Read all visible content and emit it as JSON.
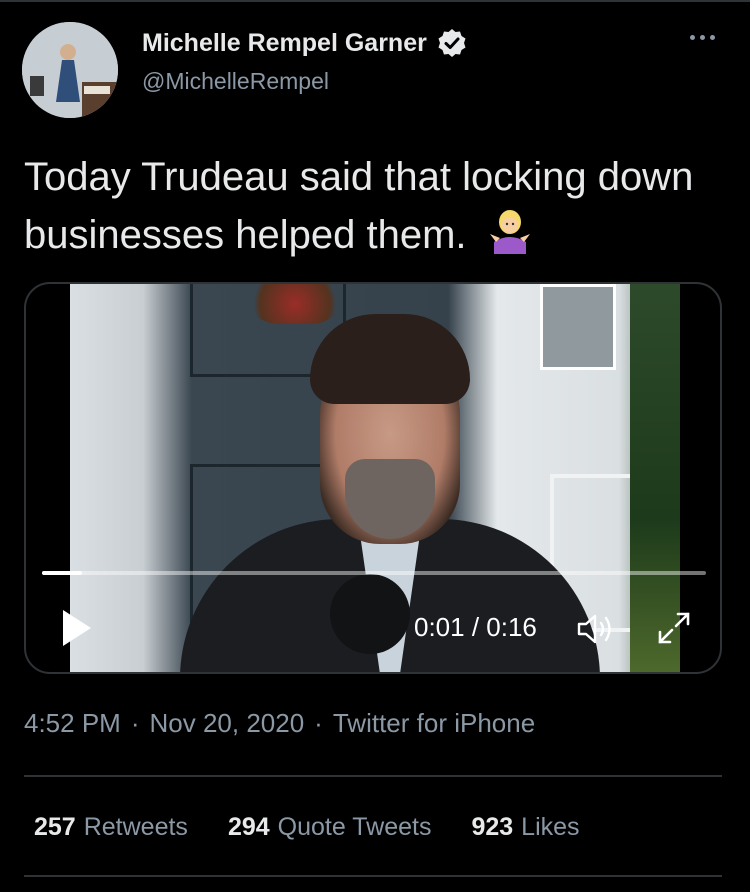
{
  "tweet": {
    "author_name": "Michelle Rempel Garner",
    "author_handle": "@MichelleRempel",
    "verified": true,
    "text": "Today Trudeau said that locking down businesses helped them.",
    "emoji": "🤷‍♀️"
  },
  "video": {
    "time_display": "0:01 / 0:16",
    "progress_fraction": 0.06
  },
  "meta": {
    "time": "4:52 PM",
    "date": "Nov 20, 2020",
    "source": "Twitter for iPhone",
    "separator": "·"
  },
  "stats": {
    "retweets_count": "257",
    "retweets_label": "Retweets",
    "quotes_count": "294",
    "quotes_label": "Quote Tweets",
    "likes_count": "923",
    "likes_label": "Likes"
  },
  "colors": {
    "background": "#000000",
    "primary_text": "#e7e9ea",
    "secondary_text": "#8b98a5",
    "divider": "#2f3336",
    "accent": "#1d9bf0"
  }
}
